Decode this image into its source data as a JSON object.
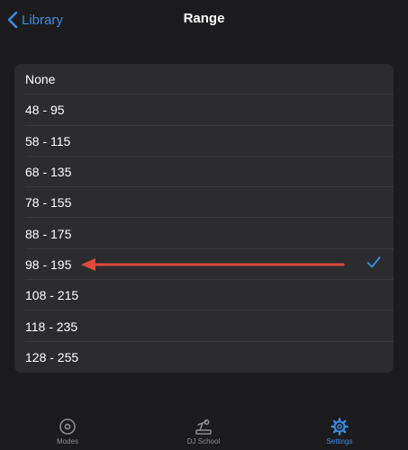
{
  "header": {
    "back_label": "Library",
    "title": "Range"
  },
  "range_options": [
    {
      "label": "None",
      "selected": false
    },
    {
      "label": "48 - 95",
      "selected": false
    },
    {
      "label": "58 - 115",
      "selected": false
    },
    {
      "label": "68 - 135",
      "selected": false
    },
    {
      "label": "78 - 155",
      "selected": false
    },
    {
      "label": "88 - 175",
      "selected": false
    },
    {
      "label": "98 - 195",
      "selected": true
    },
    {
      "label": "108 - 215",
      "selected": false
    },
    {
      "label": "118 - 235",
      "selected": false
    },
    {
      "label": "128 - 255",
      "selected": false
    }
  ],
  "tabs": [
    {
      "label": "Modes",
      "icon": "modes-disc-icon",
      "active": false
    },
    {
      "label": "DJ School",
      "icon": "dj-school-icon",
      "active": false
    },
    {
      "label": "Settings",
      "icon": "settings-gear-icon",
      "active": true
    }
  ],
  "colors": {
    "accent": "#3a8ee6",
    "annotation_arrow": "#e0483e",
    "background": "#1c1c1e",
    "list_background": "#2c2c2e"
  }
}
